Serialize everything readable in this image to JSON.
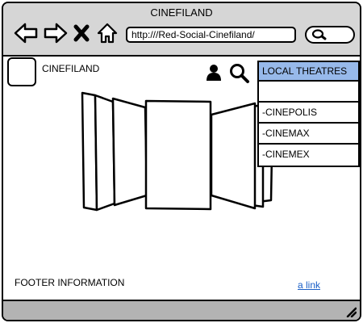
{
  "window": {
    "title": "CINEFILAND",
    "url": "http:///Red-Social-Cinefiland/"
  },
  "toolbar": {
    "back_icon": "arrow-left-icon",
    "forward_icon": "arrow-right-icon",
    "close_icon": "x-icon",
    "home_icon": "home-icon",
    "search_icon": "search-icon"
  },
  "header": {
    "brand": "CINEFILAND",
    "user_icon": "user-icon",
    "search_icon": "search-icon"
  },
  "dropdown": {
    "title": "LOCAL THEATRES",
    "items": [
      "",
      "-CINEPOLIS",
      "-CINEMAX",
      "-CINEMEX"
    ]
  },
  "footer": {
    "info": "FOOTER INFORMATION",
    "link": "a link"
  },
  "colors": {
    "chrome": "#d6d6d6",
    "statusbar": "#b3b3b3",
    "dropdown_header": "#97b9ea",
    "link": "#1a5fc7"
  }
}
